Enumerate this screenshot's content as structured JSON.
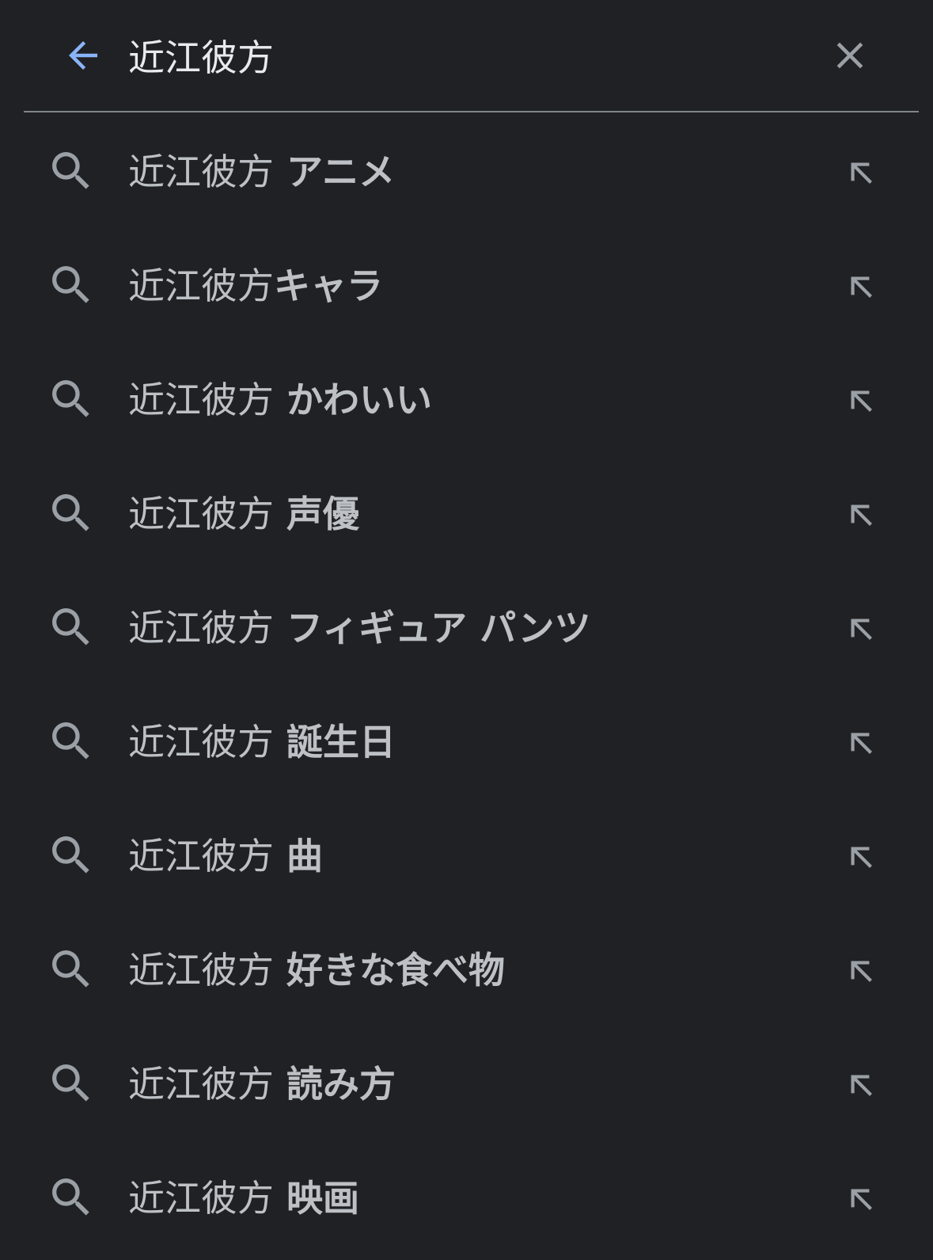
{
  "colors": {
    "background": "#202124",
    "accent": "#8ab4f8",
    "text": "#e8eaed",
    "secondary_text": "#bdc1c6",
    "icon": "#9aa0a6",
    "divider": "#80868b"
  },
  "search": {
    "query": "近江彼方",
    "back_icon": "arrow-back-icon",
    "clear_icon": "close-icon"
  },
  "suggestions": [
    {
      "query": "近江彼方",
      "completion": " アニメ"
    },
    {
      "query": "近江彼方",
      "completion": "キャラ"
    },
    {
      "query": "近江彼方",
      "completion": " かわいい"
    },
    {
      "query": "近江彼方",
      "completion": " 声優"
    },
    {
      "query": "近江彼方",
      "completion": " フィギュア パンツ"
    },
    {
      "query": "近江彼方",
      "completion": " 誕生日"
    },
    {
      "query": "近江彼方",
      "completion": " 曲"
    },
    {
      "query": "近江彼方",
      "completion": " 好きな食べ物"
    },
    {
      "query": "近江彼方",
      "completion": " 読み方"
    },
    {
      "query": "近江彼方",
      "completion": " 映画"
    }
  ]
}
